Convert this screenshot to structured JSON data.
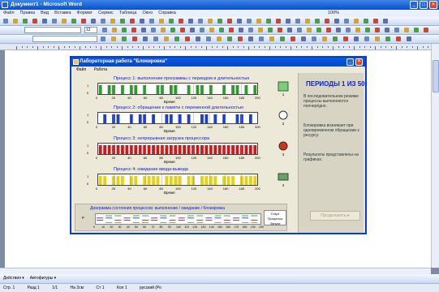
{
  "word": {
    "title": "Документ1 - Microsoft Word",
    "menu": [
      "Файл",
      "Правка",
      "Вид",
      "Вставка",
      "Формат",
      "Сервис",
      "Таблица",
      "Окно",
      "Справка"
    ],
    "font_size": "12",
    "zoom": "100%",
    "draw_label": "Действия ▾",
    "autoshapes_label": "Автофигуры ▾",
    "status": {
      "page": "Стр. 1",
      "section": "Разд 1",
      "pages": "1/1",
      "position": "На 2см",
      "line": "Ст 1",
      "col": "Кол 1",
      "lang": "русский (Ро"
    }
  },
  "app": {
    "title": "Лабораторная работа \"Блокировка\"",
    "menu": [
      "Файл",
      "Работа"
    ],
    "charts": [
      {
        "title": "Процесс 1: выполнение программы с периодом и длительностью",
        "axis": "Время",
        "icon_label": "1",
        "color": "#2e9a2e",
        "x_ticks": [
          "0",
          "20",
          "40",
          "60",
          "80",
          "100",
          "120",
          "140",
          "160",
          "180",
          "200"
        ],
        "y_ticks": [
          "1",
          "0"
        ],
        "chart_data": {
          "type": "bar",
          "values": [
            1,
            0,
            1,
            1,
            0,
            1,
            0,
            1,
            1,
            0,
            1,
            0,
            0,
            1,
            1,
            0,
            1,
            1,
            0,
            0,
            1,
            0,
            1,
            1,
            0,
            1,
            0,
            0,
            1,
            0,
            1,
            1,
            0,
            1,
            0,
            1
          ],
          "ylim": [
            0,
            1
          ]
        }
      },
      {
        "title": "Процесс 2: обращение к памяти с переменной длительностью",
        "axis": "Время",
        "icon_label": "2",
        "color": "#1f3fc8",
        "x_ticks": [
          "0",
          "20",
          "40",
          "60",
          "80",
          "100",
          "120",
          "140",
          "160",
          "180",
          "200"
        ],
        "y_ticks": [
          "1",
          "0"
        ],
        "chart_data": {
          "type": "bar",
          "values": [
            0,
            1,
            0,
            1,
            1,
            0,
            0,
            1,
            0,
            1,
            1,
            0,
            1,
            0,
            0,
            1,
            1,
            0,
            1,
            0,
            1,
            0,
            0,
            1,
            1,
            0,
            1,
            0,
            1,
            0,
            0,
            1,
            1,
            0,
            1,
            0
          ],
          "ylim": [
            0,
            1
          ]
        }
      },
      {
        "title": "Процесс 3: непрерывная загрузка процессора",
        "axis": "Время",
        "icon_label": "3",
        "color": "#cc1a1a",
        "x_ticks": [
          "0",
          "20",
          "40",
          "60",
          "80",
          "100",
          "120",
          "140",
          "160",
          "180",
          "200"
        ],
        "y_ticks": [
          "1",
          "0"
        ],
        "chart_data": {
          "type": "bar",
          "values": [
            1,
            1,
            1,
            1,
            1,
            1,
            1,
            1,
            1,
            1,
            1,
            1,
            1,
            1,
            1,
            1,
            1,
            1,
            1,
            1,
            1,
            1,
            1,
            1,
            1,
            1,
            1,
            1,
            1,
            1,
            1,
            1,
            1,
            1,
            1,
            1
          ],
          "ylim": [
            0,
            1
          ]
        }
      },
      {
        "title": "Процесс 4: ожидание ввода-вывода",
        "axis": "Время",
        "icon_label": "4",
        "color": "#e5d10f",
        "x_ticks": [
          "0",
          "20",
          "40",
          "60",
          "80",
          "100",
          "120",
          "140",
          "160",
          "180",
          "200"
        ],
        "y_ticks": [
          "1",
          "0"
        ],
        "chart_data": {
          "type": "bar",
          "values": [
            1,
            1,
            0,
            1,
            1,
            1,
            0,
            1,
            1,
            0,
            1,
            1,
            1,
            1,
            0,
            1,
            1,
            1,
            1,
            0,
            1,
            1,
            0,
            1,
            1,
            1,
            1,
            0,
            1,
            1,
            1,
            0,
            1,
            1,
            1,
            1
          ],
          "ylim": [
            0,
            1
          ]
        }
      }
    ],
    "bottom": {
      "title": "Диаграмма состояния процессов: выполнение / ожидание / блокировка",
      "axis_label": "Р",
      "button_label": "Старт\nПроцессы\nЗапуск",
      "x_ticks": [
        "0",
        "10",
        "20",
        "30",
        "40",
        "50",
        "60",
        "70",
        "80",
        "90",
        "100",
        "110",
        "120",
        "130",
        "140",
        "150",
        "160",
        "170",
        "180",
        "190",
        "200"
      ]
    },
    "right": {
      "heading": "ПЕРИОДЫ 1 ИЗ 50:",
      "text1": "В последовательном режиме процессы выполняются поочерёдно.",
      "text2": "Блокировка возникает при одновременном обращении к ресурсу.",
      "text3": "Результаты представлены на графиках.",
      "next_button": "Продолжить ▸"
    }
  }
}
